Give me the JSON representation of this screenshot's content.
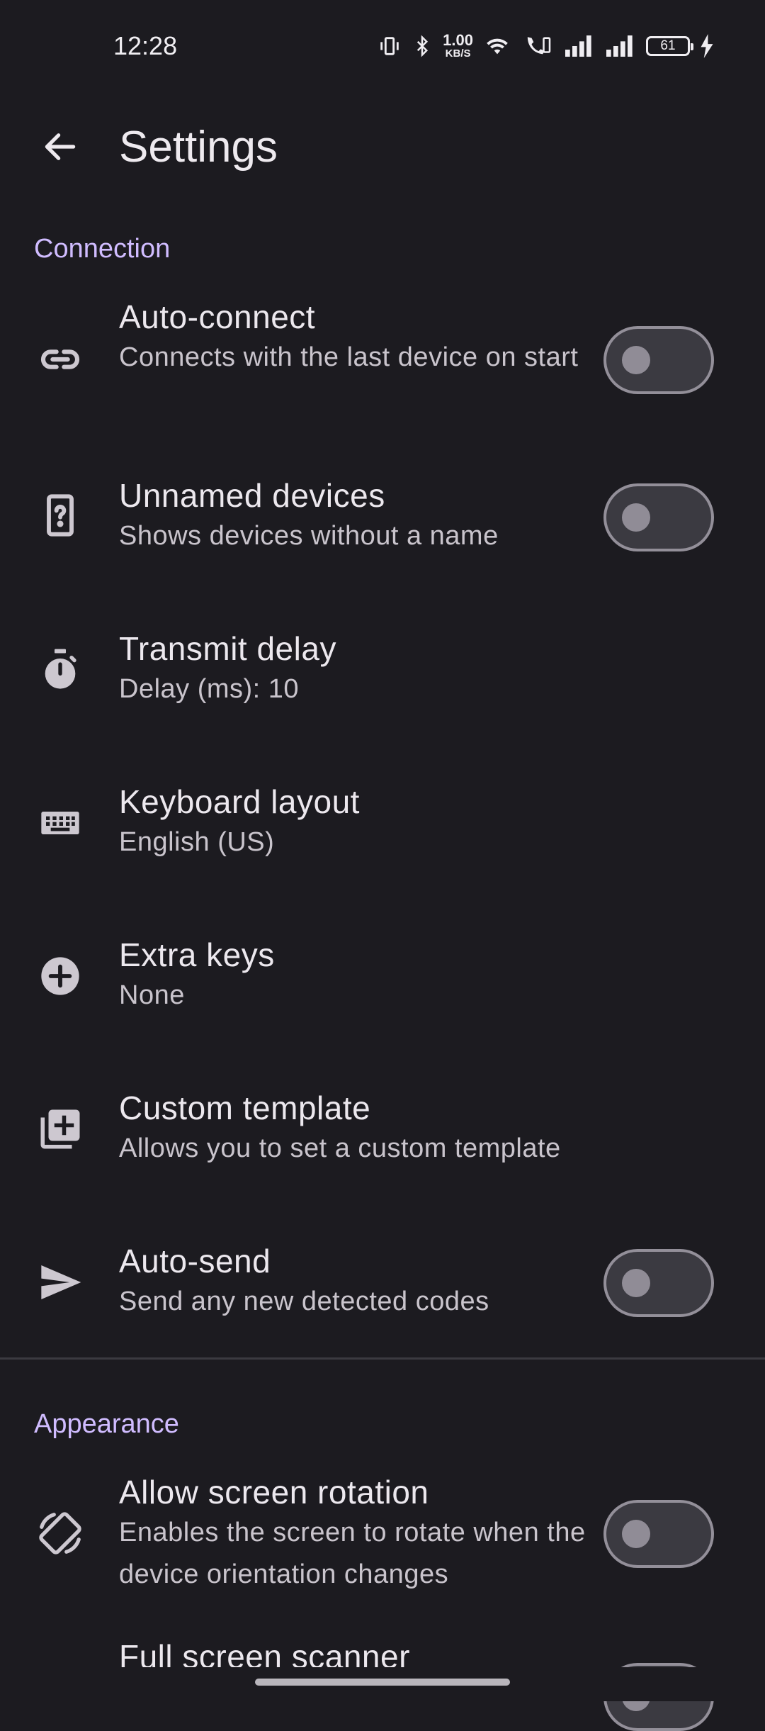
{
  "status_bar": {
    "time": "12:28",
    "net_speed_value": "1.00",
    "net_speed_unit": "KB/S",
    "battery_level": "61",
    "icons": [
      "vibrate-icon",
      "bluetooth-icon",
      "wifi-icon",
      "wifi-calling-icon",
      "signal-icon",
      "signal-icon",
      "battery-icon",
      "charging-icon"
    ]
  },
  "app_bar": {
    "title": "Settings"
  },
  "sections": [
    {
      "header": "Connection",
      "items": [
        {
          "name": "auto-connect",
          "icon": "link-icon",
          "label": "Auto-connect",
          "summary": "Connects with the last device on start",
          "switch": false
        },
        {
          "name": "unnamed-devices",
          "icon": "unknown-device-icon",
          "label": "Unnamed devices",
          "summary": "Shows devices without a name",
          "switch": false
        },
        {
          "name": "transmit-delay",
          "icon": "timer-icon",
          "label": "Transmit delay",
          "summary": "Delay (ms): 10"
        },
        {
          "name": "keyboard-layout",
          "icon": "keyboard-icon",
          "label": "Keyboard layout",
          "summary": "English (US)"
        },
        {
          "name": "extra-keys",
          "icon": "add-circle-icon",
          "label": "Extra keys",
          "summary": "None"
        },
        {
          "name": "custom-template",
          "icon": "library-add-icon",
          "label": "Custom template",
          "summary": "Allows you to set a custom template"
        },
        {
          "name": "auto-send",
          "icon": "send-icon",
          "label": "Auto-send",
          "summary": "Send any new detected codes",
          "switch": false
        }
      ]
    },
    {
      "header": "Appearance",
      "items": [
        {
          "name": "allow-screen-rotation",
          "icon": "screen-rotation-icon",
          "label": "Allow screen rotation",
          "summary": "Enables the screen to rotate when the device orientation changes",
          "switch": false
        },
        {
          "name": "full-screen-scanner",
          "label": "Full screen scanner",
          "switch": false
        }
      ]
    }
  ]
}
